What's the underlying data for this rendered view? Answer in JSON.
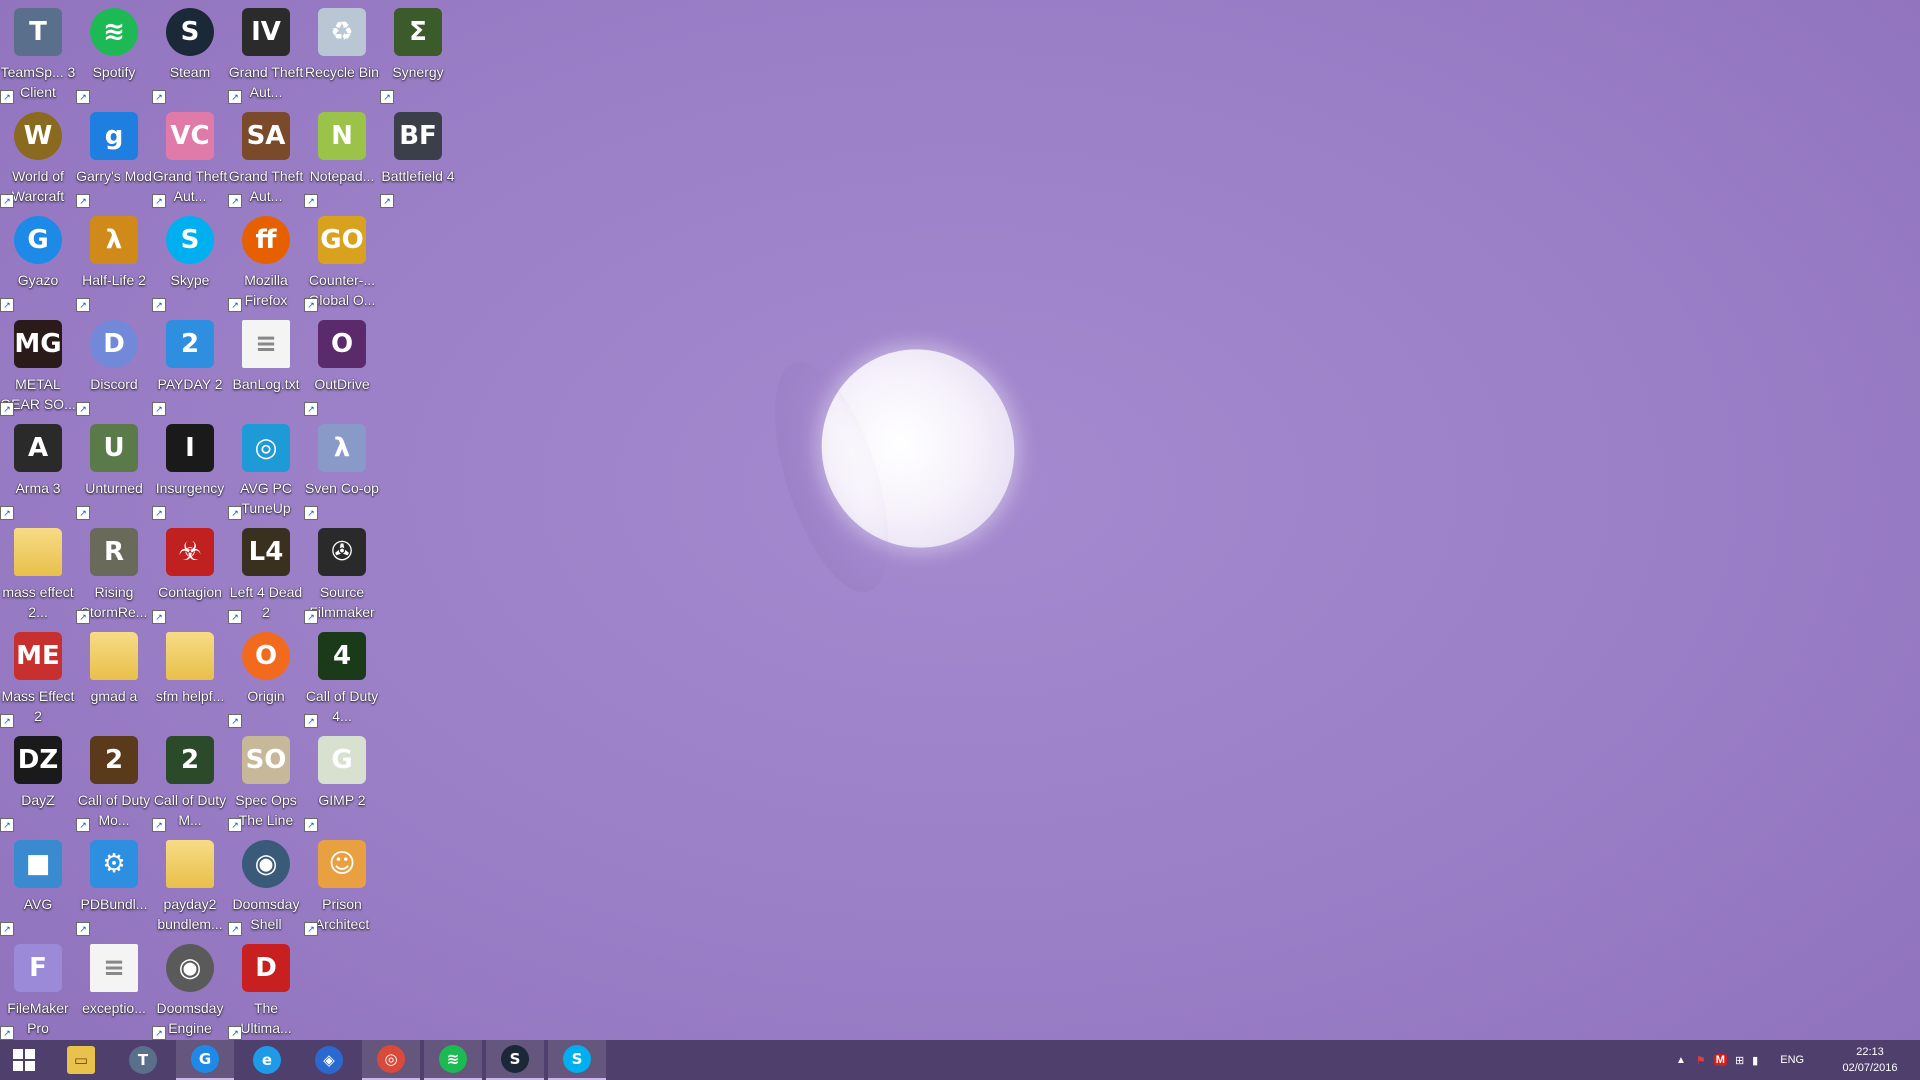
{
  "desktop": {
    "icons": [
      {
        "label": "TeamSp... 3 Client",
        "icon": "teamspeak-icon",
        "color": "#5a6f8c",
        "glyph": "T"
      },
      {
        "label": "Spotify",
        "icon": "spotify-icon",
        "color": "#1db954",
        "glyph": "≋"
      },
      {
        "label": "Steam",
        "icon": "steam-icon",
        "color": "#1b2838",
        "glyph": "S"
      },
      {
        "label": "Grand Theft Aut...",
        "icon": "gta-iv-icon",
        "color": "#2b2b2b",
        "glyph": "IV"
      },
      {
        "label": "Recycle Bin",
        "icon": "recycle-bin-icon",
        "color": "#b9c6d4",
        "glyph": "♻"
      },
      {
        "label": "Synergy",
        "icon": "synergy-icon",
        "color": "#3b5b2a",
        "glyph": "Σ"
      },
      {
        "label": "World of Warcraft",
        "icon": "warcraft-icon",
        "color": "#8a6a1e",
        "glyph": "W"
      },
      {
        "label": "Garry's Mod",
        "icon": "garrys-mod-icon",
        "color": "#1e7fe0",
        "glyph": "g"
      },
      {
        "label": "Grand Theft Aut...",
        "icon": "gta-vc-icon",
        "color": "#e07aa8",
        "glyph": "VC"
      },
      {
        "label": "Grand Theft Aut...",
        "icon": "gta-sa-icon",
        "color": "#7a4a2a",
        "glyph": "SA"
      },
      {
        "label": "Notepad...",
        "icon": "notepad-plus-icon",
        "color": "#9bc34a",
        "glyph": "N"
      },
      {
        "label": "Battlefield 4",
        "icon": "battlefield-4-icon",
        "color": "#3a3f4a",
        "glyph": "BF"
      },
      {
        "label": "Gyazo",
        "icon": "gyazo-icon",
        "color": "#1e8ae8",
        "glyph": "G"
      },
      {
        "label": "Half-Life 2",
        "icon": "half-life-2-icon",
        "color": "#d08a1a",
        "glyph": "λ"
      },
      {
        "label": "Skype",
        "icon": "skype-icon",
        "color": "#00aff0",
        "glyph": "S"
      },
      {
        "label": "Mozilla Firefox",
        "icon": "firefox-icon",
        "color": "#e66000",
        "glyph": "ff"
      },
      {
        "label": "Counter-... Global O...",
        "icon": "csgo-icon",
        "color": "#d9a21e",
        "glyph": "GO"
      },
      {
        "label": "METAL GEAR SO...",
        "icon": "metal-gear-icon",
        "color": "#2a1a1a",
        "glyph": "MG"
      },
      {
        "label": "Discord",
        "icon": "discord-icon",
        "color": "#7289da",
        "glyph": "D"
      },
      {
        "label": "PAYDAY 2",
        "icon": "payday-2-icon",
        "color": "#2e8fe0",
        "glyph": "2"
      },
      {
        "label": "BanLog.txt",
        "icon": "text-file-icon",
        "color": "#f4f4f4",
        "glyph": "≡"
      },
      {
        "label": "OutDrive",
        "icon": "outdrive-icon",
        "color": "#5a2a6a",
        "glyph": "O"
      },
      {
        "label": "Arma 3",
        "icon": "arma-3-icon",
        "color": "#2a2a2a",
        "glyph": "A"
      },
      {
        "label": "Unturned",
        "icon": "unturned-icon",
        "color": "#5a7a4a",
        "glyph": "U"
      },
      {
        "label": "Insurgency",
        "icon": "insurgency-icon",
        "color": "#1a1a1a",
        "glyph": "I"
      },
      {
        "label": "AVG PC TuneUp",
        "icon": "avg-tuneup-icon",
        "color": "#1e9ad6",
        "glyph": "◎"
      },
      {
        "label": "Sven Co-op",
        "icon": "sven-coop-icon",
        "color": "#8a9ac8",
        "glyph": "λ"
      },
      {
        "label": "mass effect 2...",
        "icon": "folder-icon",
        "color": "#f2d16b",
        "glyph": ""
      },
      {
        "label": "Rising StormRe...",
        "icon": "rising-storm-icon",
        "color": "#6a6a5a",
        "glyph": "R"
      },
      {
        "label": "Contagion",
        "icon": "contagion-icon",
        "color": "#c02020",
        "glyph": "☣"
      },
      {
        "label": "Left 4 Dead 2",
        "icon": "left-4-dead-2-icon",
        "color": "#3a3020",
        "glyph": "L4"
      },
      {
        "label": "Source Filmmaker",
        "icon": "source-filmmaker-icon",
        "color": "#2a2a2a",
        "glyph": "✇"
      },
      {
        "label": "Mass Effect 2",
        "icon": "mass-effect-2-icon",
        "color": "#c83030",
        "glyph": "ME"
      },
      {
        "label": "gmad a",
        "icon": "folder-icon",
        "color": "#f2d16b",
        "glyph": ""
      },
      {
        "label": "sfm helpf...",
        "icon": "folder-icon",
        "color": "#f2d16b",
        "glyph": ""
      },
      {
        "label": "Origin",
        "icon": "origin-icon",
        "color": "#f26a1e",
        "glyph": "O"
      },
      {
        "label": "Call of Duty 4...",
        "icon": "cod4-icon",
        "color": "#1a3a1a",
        "glyph": "4"
      },
      {
        "label": "DayZ",
        "icon": "dayz-icon",
        "color": "#1a1a1a",
        "glyph": "DZ"
      },
      {
        "label": "Call of Duty Mo...",
        "icon": "cod-mw2-icon",
        "color": "#5a3a1a",
        "glyph": "2"
      },
      {
        "label": "Call of Duty M...",
        "icon": "cod-mw2-mp-icon",
        "color": "#2a4a2a",
        "glyph": "2"
      },
      {
        "label": "Spec Ops The Line",
        "icon": "spec-ops-icon",
        "color": "#c8b89a",
        "glyph": "SO"
      },
      {
        "label": "GIMP 2",
        "icon": "gimp-icon",
        "color": "#d8e0d0",
        "glyph": "G"
      },
      {
        "label": "AVG",
        "icon": "avg-icon",
        "color": "#3a8ad0",
        "glyph": "■"
      },
      {
        "label": "PDBundl...",
        "icon": "pdbundle-icon",
        "color": "#2e8fe0",
        "glyph": "⚙"
      },
      {
        "label": "payday2 bundlem...",
        "icon": "folder-icon",
        "color": "#f2d16b",
        "glyph": ""
      },
      {
        "label": "Doomsday Shell",
        "icon": "doomsday-shell-icon",
        "color": "#3a5a7a",
        "glyph": "◉"
      },
      {
        "label": "Prison Architect",
        "icon": "prison-architect-icon",
        "color": "#e8a040",
        "glyph": "☺"
      },
      {
        "label": "FileMaker Pro",
        "icon": "filemaker-icon",
        "color": "#9a8ad8",
        "glyph": "F"
      },
      {
        "label": "exceptio...",
        "icon": "text-file-icon",
        "color": "#f4f4f4",
        "glyph": "≡"
      },
      {
        "label": "Doomsday Engine",
        "icon": "doomsday-engine-icon",
        "color": "#5a5a5a",
        "glyph": "◉"
      },
      {
        "label": "The Ultima...",
        "icon": "ultimate-doom-icon",
        "color": "#c82020",
        "glyph": "D"
      }
    ]
  },
  "taskbar": {
    "start_icon": "windows-start-icon",
    "apps": [
      {
        "name": "file-explorer",
        "icon": "folder-icon",
        "color": "#e8c24a",
        "glyph": "▭",
        "active": false
      },
      {
        "name": "teamspeak",
        "icon": "teamspeak-icon",
        "color": "#5a6f8c",
        "glyph": "T",
        "active": false
      },
      {
        "name": "gyazo",
        "icon": "gyazo-icon",
        "color": "#1e8ae8",
        "glyph": "G",
        "active": true
      },
      {
        "name": "internet-explorer",
        "icon": "internet-explorer-icon",
        "color": "#1e9ae8",
        "glyph": "e",
        "active": false
      },
      {
        "name": "unknown-app",
        "icon": "app-icon",
        "color": "#2a6ad0",
        "glyph": "◈",
        "active": false
      },
      {
        "name": "chrome",
        "icon": "chrome-icon",
        "color": "#d84a3a",
        "glyph": "◎",
        "active": true
      },
      {
        "name": "spotify",
        "icon": "spotify-icon",
        "color": "#1db954",
        "glyph": "≋",
        "active": true
      },
      {
        "name": "steam",
        "icon": "steam-icon",
        "color": "#1b2838",
        "glyph": "S",
        "active": true
      },
      {
        "name": "skype",
        "icon": "skype-icon",
        "color": "#00aff0",
        "glyph": "S",
        "active": true
      }
    ],
    "tray": {
      "language": "ENG",
      "time": "22:13",
      "date": "02/07/2016"
    }
  },
  "wallpaper": {
    "accent": "#9a7ec6"
  }
}
